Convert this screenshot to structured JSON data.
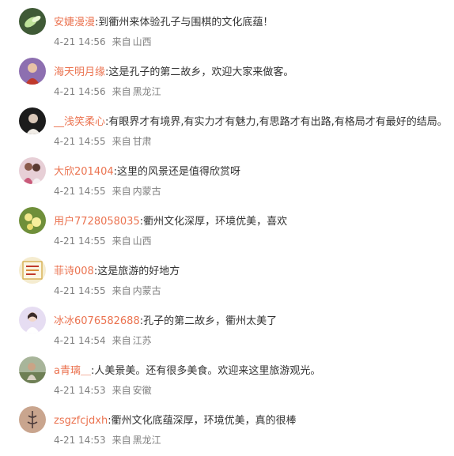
{
  "source_prefix": "来自",
  "comments": [
    {
      "user": "安婕漫漫",
      "text": ":到衢州来体验孔子与围棋的文化底蕴！",
      "time": "4-21 14:56",
      "location": "山西",
      "avatar": "leaf-avatar"
    },
    {
      "user": "海天明月缘",
      "text": ":这是孔子的第二故乡，欢迎大家来做客。",
      "time": "4-21 14:56",
      "location": "黑龙江",
      "avatar": "person-avatar"
    },
    {
      "user": "__浅笑柔心",
      "text": ":有眼界才有境界,有实力才有魅力,有思路才有出路,有格局才有最好的结局。",
      "time": "4-21 14:55",
      "location": "甘肃",
      "avatar": "dark-portrait-avatar"
    },
    {
      "user": "大欣201404",
      "text": ":这里的风景还是值得欣赏呀",
      "time": "4-21 14:55",
      "location": "内蒙古",
      "avatar": "couple-avatar"
    },
    {
      "user": "用户7728058035",
      "text": ":衢州文化深厚，环境优美，喜欢",
      "time": "4-21 14:55",
      "location": "山西",
      "avatar": "flower-avatar"
    },
    {
      "user": "菲诗008",
      "text": ":这是旅游的好地方",
      "time": "4-21 14:55",
      "location": "内蒙古",
      "avatar": "card-avatar"
    },
    {
      "user": "冰冰6076582688",
      "text": ":孔子的第二故乡，衢州太美了",
      "time": "4-21 14:54",
      "location": "江苏",
      "avatar": "girl-avatar"
    },
    {
      "user": "a青璃＿",
      "text": ":人美景美。还有很多美食。欢迎来这里旅游观光。",
      "time": "4-21 14:53",
      "location": "安徽",
      "avatar": "landscape-avatar"
    },
    {
      "user": "zsgzfcjdxh",
      "text": ":衢州文化底蕴深厚，环境优美，真的很棒",
      "time": "4-21 14:53",
      "location": "黑龙江",
      "avatar": "tattoo-avatar"
    }
  ],
  "colors": {
    "username": "#eb7350",
    "text": "#333333",
    "meta": "#808080"
  }
}
